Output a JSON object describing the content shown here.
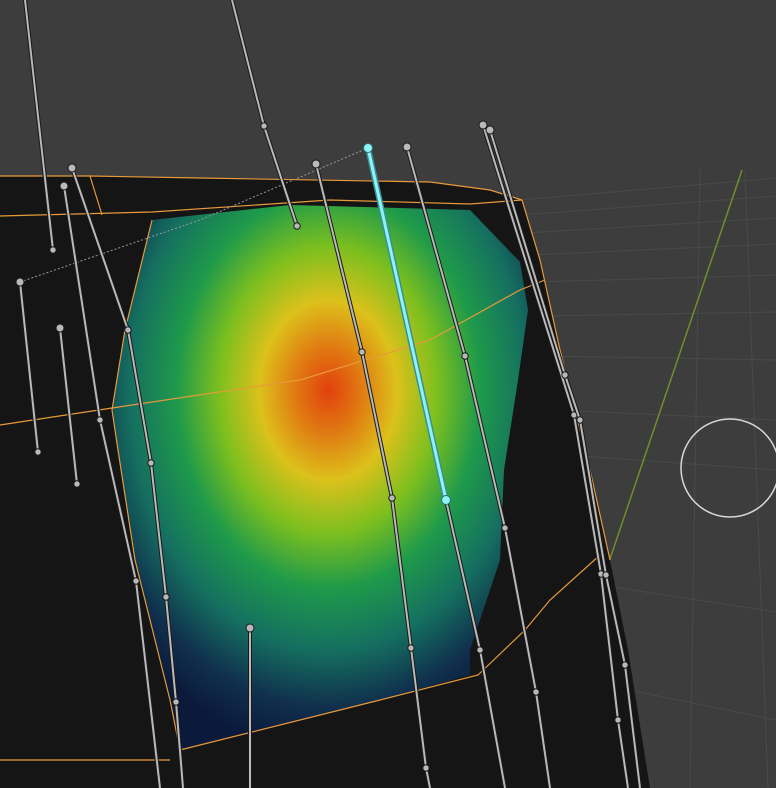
{
  "app": {
    "mode": "weight-paint"
  },
  "colors": {
    "background": "#3d3d3d",
    "grid_line": "#4a4a4a",
    "y_axis": "#6f8f2e",
    "mesh_fill": "#151515",
    "mesh_edge_selected": "#e89a3a",
    "bone": "#b9b9b9",
    "bone_outline": "#1a1a1a",
    "bone_active": "#8ff2f5",
    "gizmo": "#d8d8d8",
    "heat_cold": "#0b1a3a",
    "heat_mid": "#1f9a4a",
    "heat_warm": "#e3c51b",
    "heat_hot": "#e2400d"
  },
  "viewport": {
    "grid": true,
    "shading": "weight-paint",
    "cursor_icon": "brush-radius-circle"
  },
  "bones": [
    {
      "name": "bone-01",
      "selected": false
    },
    {
      "name": "bone-02",
      "selected": false
    },
    {
      "name": "bone-03",
      "selected": false
    },
    {
      "name": "bone-04",
      "selected": false
    },
    {
      "name": "bone-05",
      "selected": false
    },
    {
      "name": "bone-06",
      "selected": false
    },
    {
      "name": "bone-07",
      "selected": false
    },
    {
      "name": "bone-08",
      "selected": false
    },
    {
      "name": "bone-09",
      "selected": false
    },
    {
      "name": "bone-10",
      "selected": false
    },
    {
      "name": "bone-11",
      "selected": false
    },
    {
      "name": "bone-12",
      "selected": false
    },
    {
      "name": "bone-13",
      "selected": false
    },
    {
      "name": "bone-14",
      "selected": false
    },
    {
      "name": "bone-15",
      "selected": false
    },
    {
      "name": "bone-16",
      "selected": false
    },
    {
      "name": "bone-17",
      "selected": false
    },
    {
      "name": "bone-18",
      "selected": false
    },
    {
      "name": "bone-active",
      "selected": true
    }
  ]
}
